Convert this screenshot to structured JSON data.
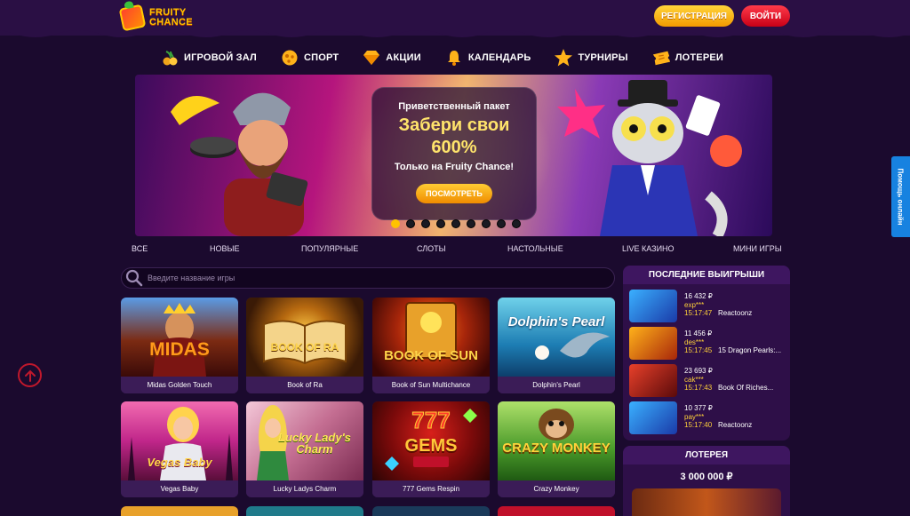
{
  "brand": {
    "logo_line1": "FRUITY",
    "logo_line2": "CHANCE"
  },
  "header": {
    "register_label": "РЕГИСТРАЦИЯ",
    "login_label": "ВОЙТИ"
  },
  "nav": [
    {
      "icon": "cherry-icon",
      "label": "ИГРОВОЙ ЗАЛ"
    },
    {
      "icon": "ball-icon",
      "label": "СПОРТ"
    },
    {
      "icon": "diamond-icon",
      "label": "АКЦИИ"
    },
    {
      "icon": "bell-icon",
      "label": "КАЛЕНДАРЬ"
    },
    {
      "icon": "star-icon",
      "label": "ТУРНИРЫ"
    },
    {
      "icon": "ticket-icon",
      "label": "ЛОТЕРЕИ"
    }
  ],
  "banner": {
    "subtitle": "Приветственный пакет",
    "title": "Забери свои 600%",
    "note": "Только на Fruity Chance!",
    "button_label": "ПОСМОТРЕТЬ",
    "slide_count": 9,
    "active_slide": 1
  },
  "help": {
    "label": "Помощь онлайн"
  },
  "categories": [
    "ВСЕ",
    "НОВЫЕ",
    "ПОПУЛЯРНЫЕ",
    "СЛОТЫ",
    "НАСТОЛЬНЫЕ",
    "LIVE КАЗИНО",
    "МИНИ ИГРЫ"
  ],
  "search": {
    "placeholder": "Введите название игры"
  },
  "games": [
    {
      "name": "Midas Golden Touch",
      "art_text": "MIDAS"
    },
    {
      "name": "Book of Ra",
      "art_text": "BOOK OF RA"
    },
    {
      "name": "Book of Sun Multichance",
      "art_text": "BOOK OF SUN"
    },
    {
      "name": "Dolphin's Pearl",
      "art_text": "Dolphin's Pearl"
    },
    {
      "name": "Vegas Baby",
      "art_text": "Vegas Baby"
    },
    {
      "name": "Lucky Ladys Charm",
      "art_text": "Lucky Lady's Charm"
    },
    {
      "name": "777 Gems Respin",
      "art_text": "GEMS"
    },
    {
      "name": "Crazy Monkey",
      "art_text": "CRAZY MONKEY"
    }
  ],
  "winners": {
    "title": "ПОСЛЕДНИЕ ВЫИГРЫШИ",
    "items": [
      {
        "amount": "16 432 ₽",
        "user": "exp***",
        "time": "15:17:47",
        "game": "Reactoonz"
      },
      {
        "amount": "11 456 ₽",
        "user": "des***",
        "time": "15:17:45",
        "game": "15 Dragon Pearls:..."
      },
      {
        "amount": "23 693 ₽",
        "user": "cak***",
        "time": "15:17:43",
        "game": "Book Of Riches..."
      },
      {
        "amount": "10 377 ₽",
        "user": "pay***",
        "time": "15:17:40",
        "game": "Reactoonz"
      }
    ]
  },
  "lottery": {
    "title": "ЛОТЕРЕЯ",
    "amount": "3 000 000 ₽"
  },
  "colors": {
    "background": "#1b0a2e",
    "accent_gold": "#ffc400",
    "login_red": "#e0102a",
    "help_blue": "#1782e0"
  }
}
